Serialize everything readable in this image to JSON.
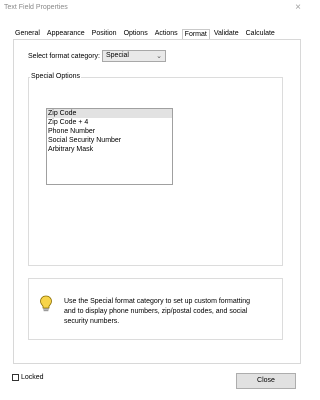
{
  "window": {
    "title": "Text Field Properties",
    "close_glyph": "×"
  },
  "tabs": [
    {
      "label": "General"
    },
    {
      "label": "Appearance"
    },
    {
      "label": "Position"
    },
    {
      "label": "Options"
    },
    {
      "label": "Actions"
    },
    {
      "label": "Format",
      "active": true
    },
    {
      "label": "Validate"
    },
    {
      "label": "Calculate"
    }
  ],
  "format": {
    "category_label": "Select format category:",
    "category_value": "Special",
    "chevron_glyph": "⌄"
  },
  "special_options": {
    "legend": "Special Options",
    "items": [
      "Zip Code",
      "Zip Code + 4",
      "Phone Number",
      "Social Security Number",
      "Arbitrary Mask"
    ],
    "selected_index": 0
  },
  "info": {
    "icon": "lightbulb-icon",
    "line1": "Use the Special format category to set up custom formatting",
    "line2": "and to display phone numbers, zip/postal codes, and social",
    "line3": "security numbers."
  },
  "footer": {
    "locked_label": "Locked",
    "locked_checked": false,
    "close_label": "Close"
  },
  "colors": {
    "bulb_fill": "#f7d44a",
    "bulb_stroke": "#8a6d00"
  }
}
